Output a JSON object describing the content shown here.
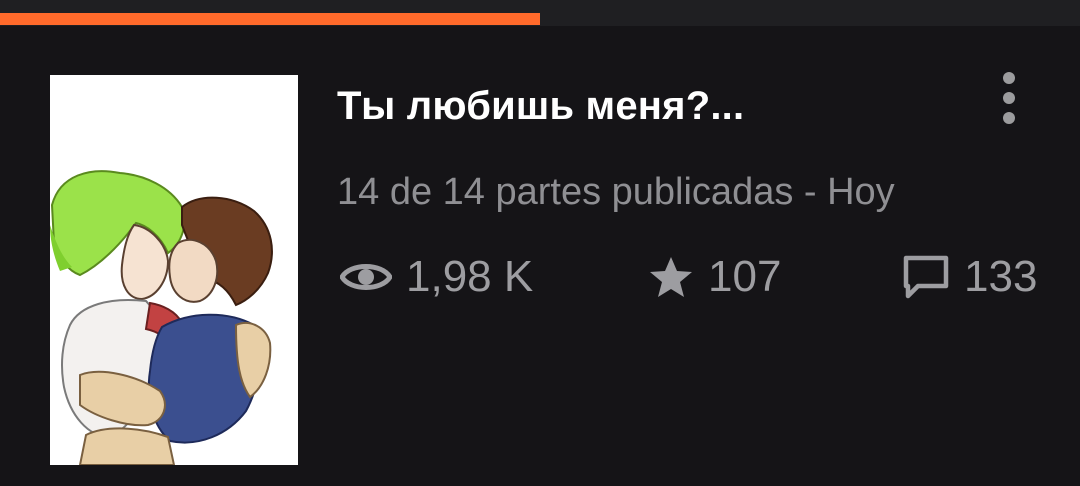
{
  "reading_progress": 0.5,
  "colors": {
    "accent": "#ff6a2b",
    "background": "#151417",
    "title": "#ffffff",
    "meta": "#8f8f93"
  },
  "story": {
    "title": "Ты любишь меня?...",
    "subtitle": "14 de 14 partes publicadas - Hoy",
    "stats": {
      "views": "1,98 K",
      "votes": "107",
      "comments": "133"
    }
  },
  "icons": {
    "views": "eye-icon",
    "votes": "star-icon",
    "comments": "comment-icon",
    "menu": "more-vertical-icon"
  }
}
